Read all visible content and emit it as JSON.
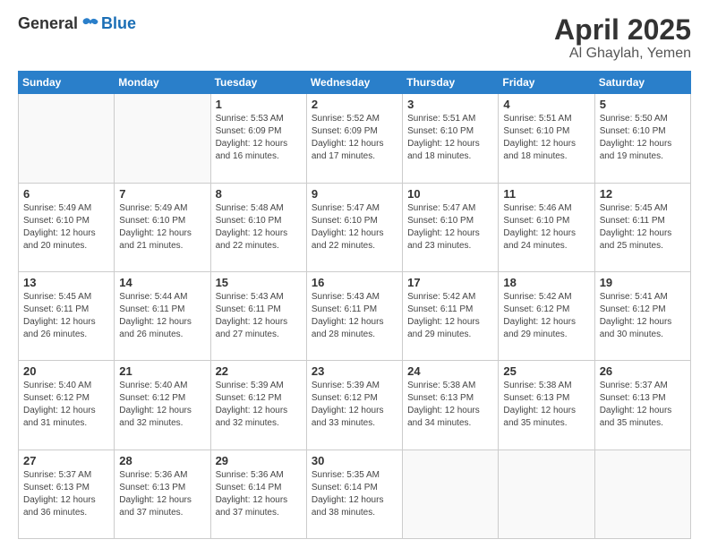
{
  "header": {
    "logo_general": "General",
    "logo_blue": "Blue",
    "title": "April 2025",
    "location": "Al Ghaylah, Yemen"
  },
  "days_of_week": [
    "Sunday",
    "Monday",
    "Tuesday",
    "Wednesday",
    "Thursday",
    "Friday",
    "Saturday"
  ],
  "weeks": [
    [
      {
        "day": "",
        "sunrise": "",
        "sunset": "",
        "daylight": ""
      },
      {
        "day": "",
        "sunrise": "",
        "sunset": "",
        "daylight": ""
      },
      {
        "day": "1",
        "sunrise": "Sunrise: 5:53 AM",
        "sunset": "Sunset: 6:09 PM",
        "daylight": "Daylight: 12 hours and 16 minutes."
      },
      {
        "day": "2",
        "sunrise": "Sunrise: 5:52 AM",
        "sunset": "Sunset: 6:09 PM",
        "daylight": "Daylight: 12 hours and 17 minutes."
      },
      {
        "day": "3",
        "sunrise": "Sunrise: 5:51 AM",
        "sunset": "Sunset: 6:10 PM",
        "daylight": "Daylight: 12 hours and 18 minutes."
      },
      {
        "day": "4",
        "sunrise": "Sunrise: 5:51 AM",
        "sunset": "Sunset: 6:10 PM",
        "daylight": "Daylight: 12 hours and 18 minutes."
      },
      {
        "day": "5",
        "sunrise": "Sunrise: 5:50 AM",
        "sunset": "Sunset: 6:10 PM",
        "daylight": "Daylight: 12 hours and 19 minutes."
      }
    ],
    [
      {
        "day": "6",
        "sunrise": "Sunrise: 5:49 AM",
        "sunset": "Sunset: 6:10 PM",
        "daylight": "Daylight: 12 hours and 20 minutes."
      },
      {
        "day": "7",
        "sunrise": "Sunrise: 5:49 AM",
        "sunset": "Sunset: 6:10 PM",
        "daylight": "Daylight: 12 hours and 21 minutes."
      },
      {
        "day": "8",
        "sunrise": "Sunrise: 5:48 AM",
        "sunset": "Sunset: 6:10 PM",
        "daylight": "Daylight: 12 hours and 22 minutes."
      },
      {
        "day": "9",
        "sunrise": "Sunrise: 5:47 AM",
        "sunset": "Sunset: 6:10 PM",
        "daylight": "Daylight: 12 hours and 22 minutes."
      },
      {
        "day": "10",
        "sunrise": "Sunrise: 5:47 AM",
        "sunset": "Sunset: 6:10 PM",
        "daylight": "Daylight: 12 hours and 23 minutes."
      },
      {
        "day": "11",
        "sunrise": "Sunrise: 5:46 AM",
        "sunset": "Sunset: 6:10 PM",
        "daylight": "Daylight: 12 hours and 24 minutes."
      },
      {
        "day": "12",
        "sunrise": "Sunrise: 5:45 AM",
        "sunset": "Sunset: 6:11 PM",
        "daylight": "Daylight: 12 hours and 25 minutes."
      }
    ],
    [
      {
        "day": "13",
        "sunrise": "Sunrise: 5:45 AM",
        "sunset": "Sunset: 6:11 PM",
        "daylight": "Daylight: 12 hours and 26 minutes."
      },
      {
        "day": "14",
        "sunrise": "Sunrise: 5:44 AM",
        "sunset": "Sunset: 6:11 PM",
        "daylight": "Daylight: 12 hours and 26 minutes."
      },
      {
        "day": "15",
        "sunrise": "Sunrise: 5:43 AM",
        "sunset": "Sunset: 6:11 PM",
        "daylight": "Daylight: 12 hours and 27 minutes."
      },
      {
        "day": "16",
        "sunrise": "Sunrise: 5:43 AM",
        "sunset": "Sunset: 6:11 PM",
        "daylight": "Daylight: 12 hours and 28 minutes."
      },
      {
        "day": "17",
        "sunrise": "Sunrise: 5:42 AM",
        "sunset": "Sunset: 6:11 PM",
        "daylight": "Daylight: 12 hours and 29 minutes."
      },
      {
        "day": "18",
        "sunrise": "Sunrise: 5:42 AM",
        "sunset": "Sunset: 6:12 PM",
        "daylight": "Daylight: 12 hours and 29 minutes."
      },
      {
        "day": "19",
        "sunrise": "Sunrise: 5:41 AM",
        "sunset": "Sunset: 6:12 PM",
        "daylight": "Daylight: 12 hours and 30 minutes."
      }
    ],
    [
      {
        "day": "20",
        "sunrise": "Sunrise: 5:40 AM",
        "sunset": "Sunset: 6:12 PM",
        "daylight": "Daylight: 12 hours and 31 minutes."
      },
      {
        "day": "21",
        "sunrise": "Sunrise: 5:40 AM",
        "sunset": "Sunset: 6:12 PM",
        "daylight": "Daylight: 12 hours and 32 minutes."
      },
      {
        "day": "22",
        "sunrise": "Sunrise: 5:39 AM",
        "sunset": "Sunset: 6:12 PM",
        "daylight": "Daylight: 12 hours and 32 minutes."
      },
      {
        "day": "23",
        "sunrise": "Sunrise: 5:39 AM",
        "sunset": "Sunset: 6:12 PM",
        "daylight": "Daylight: 12 hours and 33 minutes."
      },
      {
        "day": "24",
        "sunrise": "Sunrise: 5:38 AM",
        "sunset": "Sunset: 6:13 PM",
        "daylight": "Daylight: 12 hours and 34 minutes."
      },
      {
        "day": "25",
        "sunrise": "Sunrise: 5:38 AM",
        "sunset": "Sunset: 6:13 PM",
        "daylight": "Daylight: 12 hours and 35 minutes."
      },
      {
        "day": "26",
        "sunrise": "Sunrise: 5:37 AM",
        "sunset": "Sunset: 6:13 PM",
        "daylight": "Daylight: 12 hours and 35 minutes."
      }
    ],
    [
      {
        "day": "27",
        "sunrise": "Sunrise: 5:37 AM",
        "sunset": "Sunset: 6:13 PM",
        "daylight": "Daylight: 12 hours and 36 minutes."
      },
      {
        "day": "28",
        "sunrise": "Sunrise: 5:36 AM",
        "sunset": "Sunset: 6:13 PM",
        "daylight": "Daylight: 12 hours and 37 minutes."
      },
      {
        "day": "29",
        "sunrise": "Sunrise: 5:36 AM",
        "sunset": "Sunset: 6:14 PM",
        "daylight": "Daylight: 12 hours and 37 minutes."
      },
      {
        "day": "30",
        "sunrise": "Sunrise: 5:35 AM",
        "sunset": "Sunset: 6:14 PM",
        "daylight": "Daylight: 12 hours and 38 minutes."
      },
      {
        "day": "",
        "sunrise": "",
        "sunset": "",
        "daylight": ""
      },
      {
        "day": "",
        "sunrise": "",
        "sunset": "",
        "daylight": ""
      },
      {
        "day": "",
        "sunrise": "",
        "sunset": "",
        "daylight": ""
      }
    ]
  ]
}
